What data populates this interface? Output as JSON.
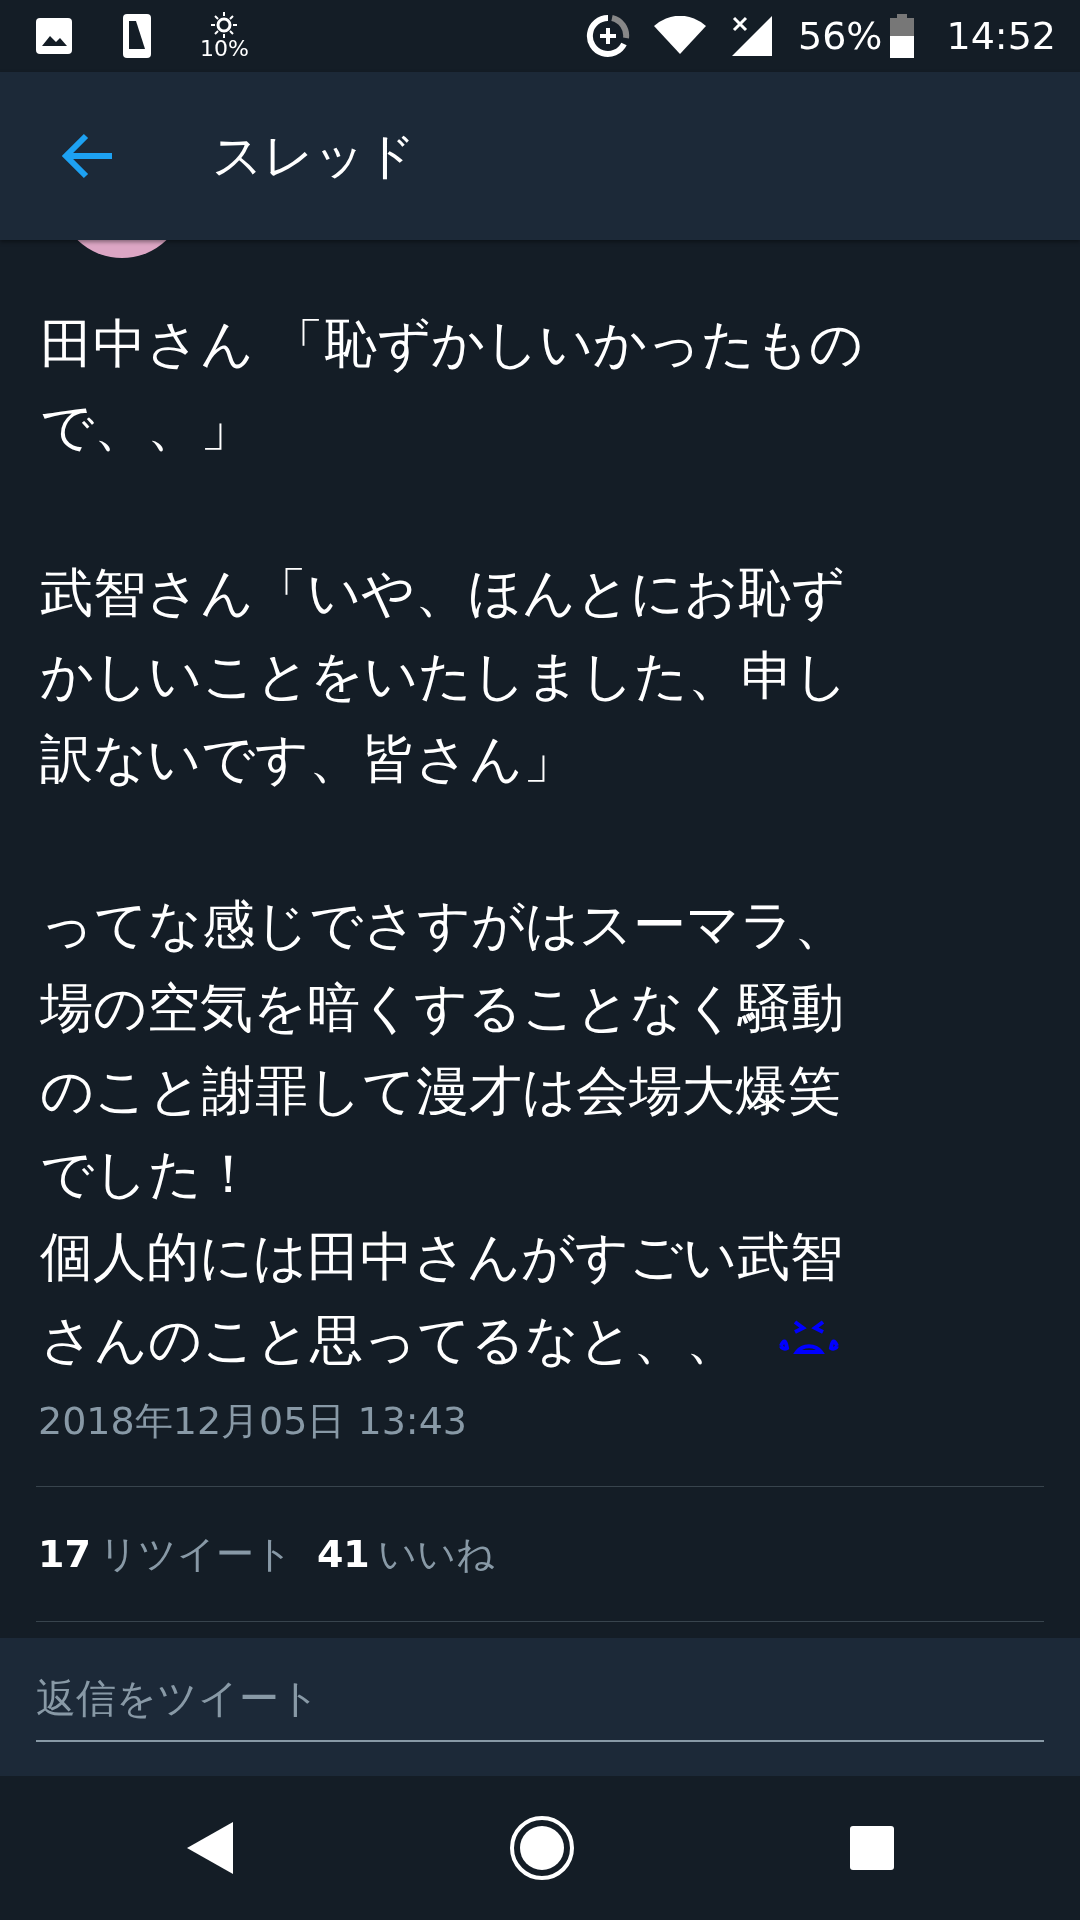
{
  "status_bar": {
    "brightness": "10%",
    "battery": "56%",
    "time": "14:52"
  },
  "header": {
    "title": "スレッド"
  },
  "tweet": {
    "paragraphs": [
      {
        "lines": [
          "田中さん 「恥ずかしいかったもの",
          "で、、」"
        ]
      },
      {
        "lines": [
          "武智さん「いや、ほんとにお恥ず",
          "かしいことをいたしました、申し",
          "訳ないです、皆さん」"
        ]
      },
      {
        "lines": [
          "ってな感じでさすがはスーマラ、",
          "場の空気を暗くすることなく騒動",
          "のこと謝罪して漫才は会場大爆笑",
          "でした！",
          "個人的には田中さんがすごい武智",
          "さんのこと思ってるなと、、"
        ]
      }
    ],
    "timestamp": "2018年12月05日 13:43",
    "stats": [
      {
        "count": "17",
        "label": "リツイート"
      },
      {
        "count": "41",
        "label": "いいね"
      }
    ]
  },
  "reply": {
    "placeholder": "返信をツイート"
  }
}
